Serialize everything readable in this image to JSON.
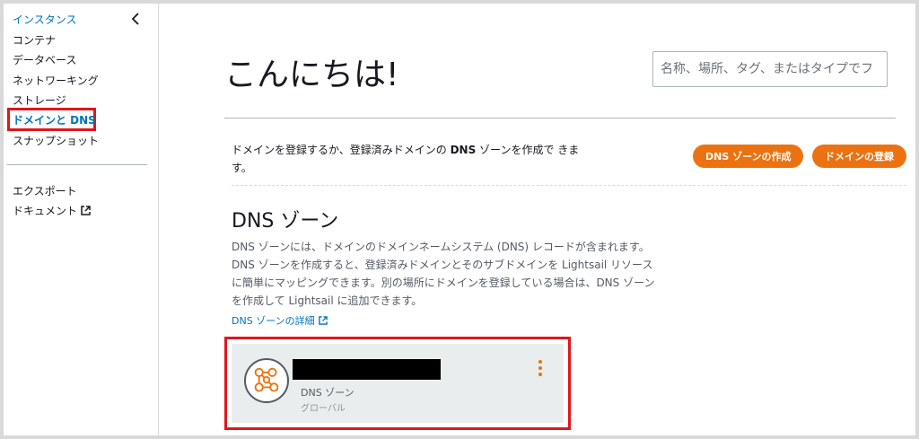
{
  "sidebar": {
    "items": [
      {
        "label": "インスタンス"
      },
      {
        "label": "コンテナ"
      },
      {
        "label": "データベース"
      },
      {
        "label": "ネットワーキング"
      },
      {
        "label": "ストレージ"
      },
      {
        "label": "ドメインと DNS"
      },
      {
        "label": "スナップショット"
      }
    ],
    "secondary": [
      {
        "label": "エクスポート"
      },
      {
        "label": "ドキュメント"
      }
    ]
  },
  "header": {
    "greeting": "こんにちは!",
    "search_placeholder": "名称、場所、タグ、またはタイプでフ"
  },
  "intro": {
    "text_before": "ドメインを登録するか、登録済みドメインの ",
    "text_bold": "DNS",
    "text_after": " ゾーンを作成で きます。",
    "create_zone_button": "DNS ゾーンの作成",
    "register_domain_button": "ドメインの登録"
  },
  "dns_section": {
    "title": "DNS ゾーン",
    "description": "DNS ゾーンには、ドメインのドメインネームシステム (DNS) レコードが含まれます。DNS ゾーンを作成すると、登録済みドメインとそのサブドメインを Lightsail リソースに簡単にマッピングできます。別の場所にドメインを登録している場合は、DNS ゾーンを作成して Lightsail に追加できます。",
    "learn_more": "DNS ゾーンの詳細",
    "card": {
      "type": "DNS ゾーン",
      "region": "グローバル"
    }
  },
  "colors": {
    "accent": "#0073bb",
    "button": "#ec7211",
    "highlight": "#e0161b"
  }
}
